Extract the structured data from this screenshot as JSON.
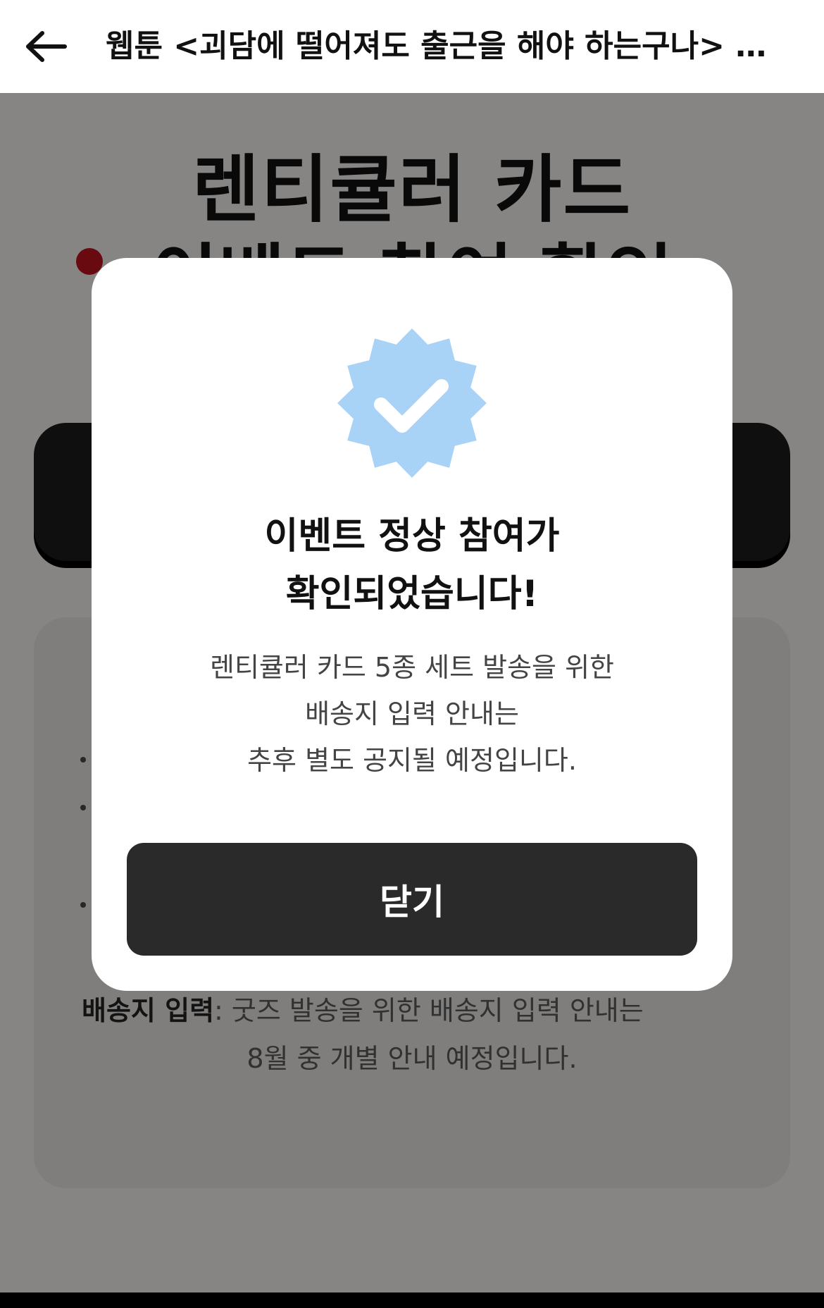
{
  "header": {
    "title": "웹툰 <괴담에 떨어져도 출근을 해야 하는구나> 소..."
  },
  "page": {
    "title_line1": "렌티큘러 카드",
    "title_line2": "이벤트 참여 확인",
    "info_label": "배송지 입력",
    "info_text": ": 굿즈 발송을 위한 배송지 입력 안내는",
    "info_text_2": "8월 중 개별 안내 예정입니다."
  },
  "modal": {
    "icon": "verified-check-badge",
    "title_line1": "이벤트 정상 참여가",
    "title_line2": "확인되었습니다!",
    "desc_line1": "렌티큘러 카드 5종 세트 발송을 위한",
    "desc_line2": "배송지 입력 안내는",
    "desc_line3": "추후 별도 공지될 예정입니다.",
    "close_label": "닫기"
  },
  "colors": {
    "badge": "#a9d2f7",
    "button": "#2a2a2a",
    "accent_dot": "#b3121c"
  }
}
